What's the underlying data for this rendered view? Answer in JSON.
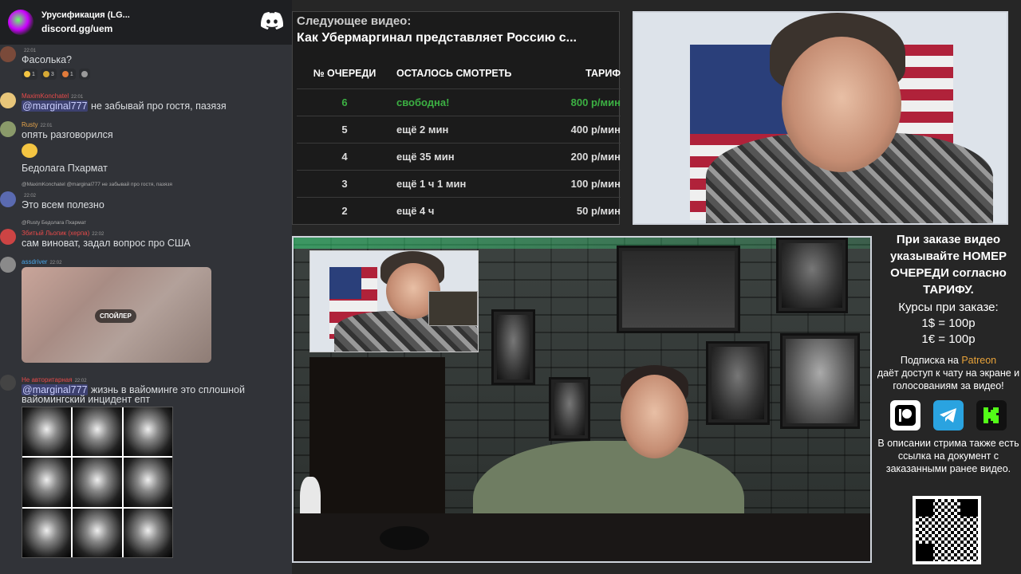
{
  "discord": {
    "server_title": "Урусификация (LG...",
    "server_link": "discord.gg/uem",
    "messages": [
      {
        "user": "",
        "time": "22:01",
        "text": "Фасолька?"
      },
      {
        "user": "MaximKonchatel",
        "time": "22:01",
        "mention": "@marginal777",
        "text": " не забывай про гостя, пазязя"
      },
      {
        "user": "Rusty",
        "time": "22:01",
        "text": "опять разговорился"
      },
      {
        "user": "",
        "time": "",
        "text": "Бедолага Пхармат"
      },
      {
        "user": "",
        "time": "22:02",
        "reply": "@MaximKonchatel @marginal777 не забывай про гостя, пазязя",
        "text": "Это всем полезно"
      },
      {
        "user": "Збитый Льопик (херпа)",
        "time": "22:02",
        "reply": "@Rusty Бедолага Пхармат",
        "text": "сам виноват, задал вопрос про США"
      },
      {
        "user": "assdriver",
        "time": "22:02",
        "text": ""
      },
      {
        "user": "Не авторитарная",
        "time": "22:02",
        "mention": "@marginal777",
        "text": " жизнь в вайоминге это сплошной",
        "text2": "вайомингский инцидент епт"
      }
    ],
    "reactions": [
      {
        "count": "1"
      },
      {
        "count": "3"
      },
      {
        "count": "1"
      }
    ],
    "spoiler_label": "СПОЙЛЕР"
  },
  "queue": {
    "next_label": "Следующее видео:",
    "next_title": "Как Убермаргинал представляет Россию с...",
    "headers": {
      "num": "№ ОЧЕРЕДИ",
      "left": "ОСТАЛОСЬ СМОТРЕТЬ",
      "rate": "ТАРИФ"
    },
    "rows": [
      {
        "num": "6",
        "left": "свободна!",
        "rate": "800 р/мин"
      },
      {
        "num": "5",
        "left": "ещё 2 мин",
        "rate": "400 р/мин"
      },
      {
        "num": "4",
        "left": "ещё 35 мин",
        "rate": "200 р/мин"
      },
      {
        "num": "3",
        "left": "ещё 1 ч 1 мин",
        "rate": "100 р/мин"
      },
      {
        "num": "2",
        "left": "ещё 4 ч",
        "rate": "50 р/мин"
      }
    ]
  },
  "info": {
    "order_lines": [
      "При заказе видео",
      "указывайте НОМЕР",
      "ОЧЕРЕДИ согласно",
      "ТАРИФУ."
    ],
    "rates_title": "Курсы при заказе:",
    "usd_rate": "1$ = 100р",
    "eur_rate": "1€ = 100р",
    "patreon_pre": "Подписка на ",
    "patreon_word": "Patreon",
    "patreon_post": "даёт доступ к чату на экране и голосованиям за видео!",
    "desc": "В описании стрима также есть ссылка на документ с заказанными ранее видео.",
    "colors": {
      "patreon": "#e8a33a",
      "telegram": "#2aa3e0",
      "kick": "#53fc18"
    }
  }
}
